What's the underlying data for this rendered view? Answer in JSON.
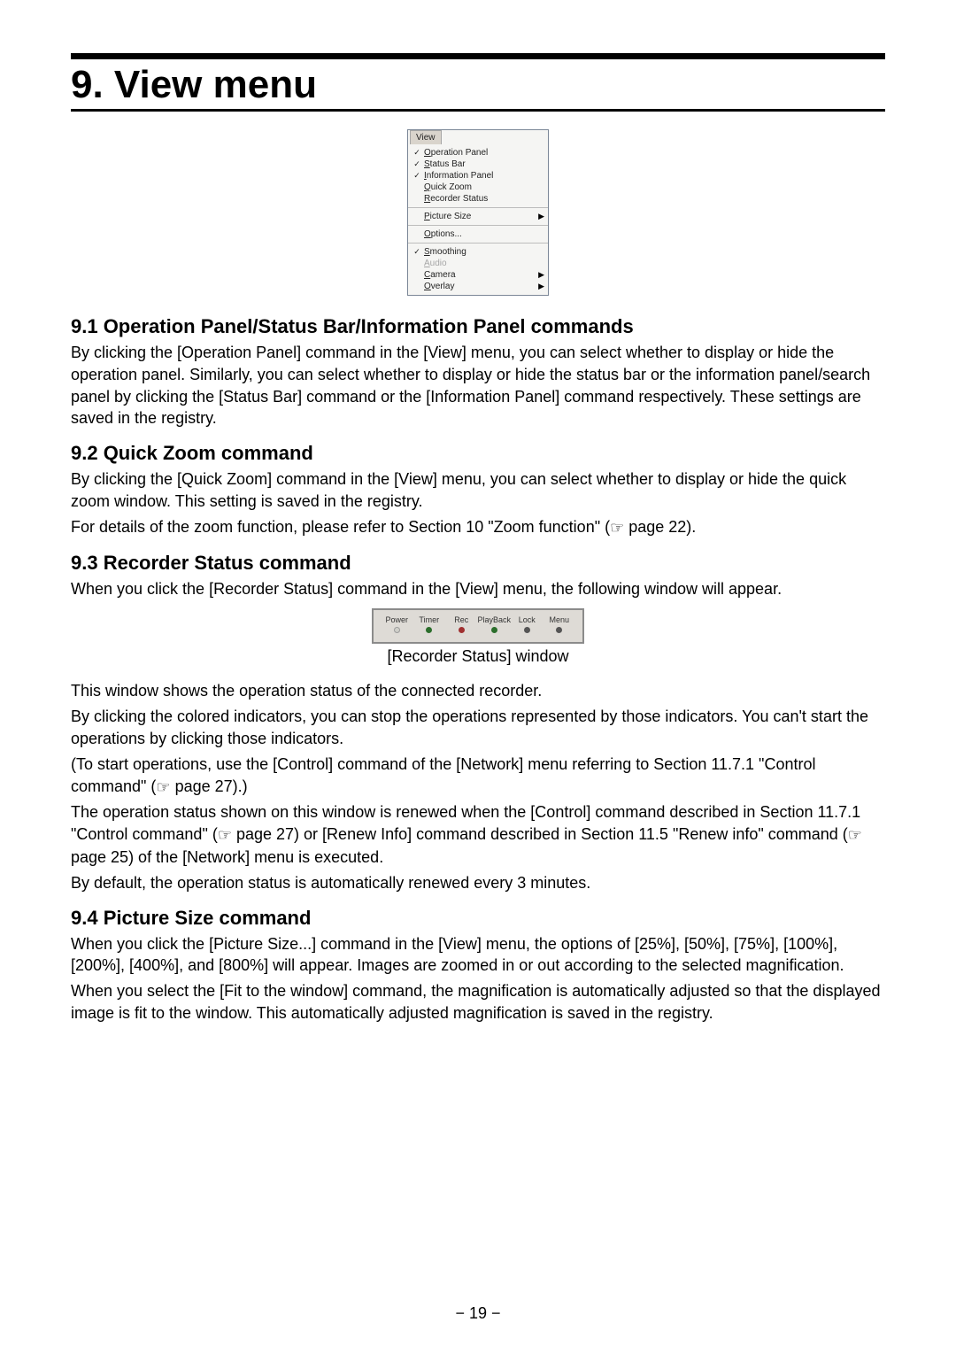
{
  "chapter": {
    "title": "9. View menu"
  },
  "viewMenu": {
    "tabLabel": "View",
    "group1": [
      {
        "checked": true,
        "label": "Operation Panel"
      },
      {
        "checked": true,
        "label": "Status Bar"
      },
      {
        "checked": true,
        "label": "Information Panel"
      },
      {
        "checked": false,
        "label": "Quick Zoom"
      },
      {
        "checked": false,
        "label": "Recorder Status"
      }
    ],
    "group2": [
      {
        "checked": false,
        "label": "Picture Size",
        "arrow": true
      }
    ],
    "group3": [
      {
        "checked": false,
        "label": "Options..."
      }
    ],
    "group4": [
      {
        "checked": true,
        "label": "Smoothing"
      },
      {
        "checked": false,
        "label": "Audio",
        "disabled": true
      },
      {
        "checked": false,
        "label": "Camera",
        "arrow": true
      },
      {
        "checked": false,
        "label": "Overlay",
        "arrow": true
      }
    ]
  },
  "sections": {
    "s91": {
      "heading": "9.1 Operation Panel/Status Bar/Information Panel commands",
      "p1": "By clicking the [Operation Panel] command in the [View] menu, you can select whether to display or hide the operation panel. Similarly, you can select whether to display or hide the status bar or the information panel/search panel by clicking the [Status Bar] command or the [Information Panel] command respectively. These settings are saved in the registry."
    },
    "s92": {
      "heading": "9.2 Quick Zoom command",
      "p1": "By clicking the [Quick Zoom] command in the [View] menu, you can select whether to display or hide the quick zoom window. This setting is saved in the registry.",
      "p2a": "For details of the zoom function, please refer to Section 10 \"Zoom function\" (",
      "ref1": "☞",
      "p2b": " page 22)."
    },
    "s93": {
      "heading": "9.3  Recorder Status command",
      "p1": "When you click the [Recorder Status] command in the [View] menu, the following window will appear.",
      "caption": "[Recorder Status] window",
      "p2": "This window shows the operation status of the connected recorder.",
      "p3": "By clicking the colored indicators, you can stop the operations represented by those indicators. You can't start the operations by clicking those indicators.",
      "p4a": "(To start operations, use the [Control] command of the [Network] menu referring to Section 11.7.1 \"Control command\" (",
      "ref2": "☞",
      "p4b": " page 27).)",
      "p5a": "The operation status shown on this window is renewed when the [Control] command described in Section 11.7.1 \"Control command\" (",
      "ref3": "☞",
      "p5b": " page 27) or [Renew Info] command described in Section 11.5 \"Renew info\" command (",
      "ref4": "☞",
      "p5c": " page 25) of the [Network] menu is executed.",
      "p6": "By default, the operation status is automatically renewed every 3 minutes."
    },
    "s94": {
      "heading": "9.4  Picture Size command",
      "p1": "When you click the [Picture Size...] command in the [View] menu, the options of [25%], [50%], [75%], [100%], [200%], [400%], and [800%] will appear. Images are zoomed in or out according to the selected magnification.",
      "p2": "When you select the [Fit to the window] command, the magnification is automatically adjusted so that the displayed image is fit to the window. This automatically adjusted magnification is saved in the registry."
    }
  },
  "recorderStatus": {
    "cols": [
      {
        "label": "Power",
        "dot": "off"
      },
      {
        "label": "Timer",
        "dot": "green"
      },
      {
        "label": "Rec",
        "dot": "red"
      },
      {
        "label": "PlayBack",
        "dot": "green"
      },
      {
        "label": "Lock",
        "dot": "dark"
      },
      {
        "label": "Menu",
        "dot": "dark"
      }
    ]
  },
  "pageNumber": "− 19 −"
}
